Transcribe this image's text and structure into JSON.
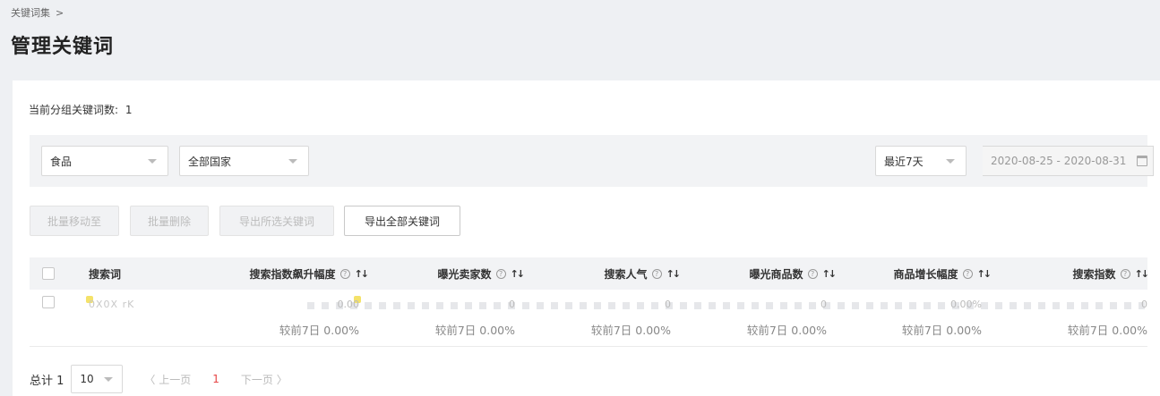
{
  "breadcrumb": {
    "text": "关键词集",
    "separator": ">"
  },
  "page": {
    "title": "管理关键词"
  },
  "summary": {
    "label": "当前分组关键词数:",
    "value": "1"
  },
  "filters": {
    "category": "食品",
    "country": "全部国家",
    "period": "最近7天",
    "date_range": "2020-08-25 - 2020-08-31"
  },
  "actions": {
    "move": "批量移动至",
    "delete": "批量删除",
    "export_selected": "导出所选关键词",
    "export_all": "导出全部关键词"
  },
  "table": {
    "columns": [
      "搜索词",
      "搜索指数飙升幅度",
      "曝光卖家数",
      "搜索人气",
      "曝光商品数",
      "商品增长幅度",
      "搜索指数"
    ],
    "help_glyph": "?",
    "sort_glyph": "↑↓",
    "rows": [
      {
        "keyword": "0X0X rK",
        "values": [
          "0.00",
          "0",
          "0",
          "0",
          "0.00%",
          "0"
        ],
        "compare": [
          "较前7日  0.00%",
          "较前7日  0.00%",
          "较前7日  0.00%",
          "较前7日  0.00%",
          "较前7日  0.00%",
          "较前7日  0.00%"
        ]
      }
    ]
  },
  "pagination": {
    "total": "总计 1",
    "page_size": "10",
    "prev": "〈 上一页",
    "current": "1",
    "next": "下一页 〉"
  },
  "colors": {
    "accent": "#e64545",
    "panel_bg": "#ffffff",
    "page_bg": "#eef0f3"
  }
}
